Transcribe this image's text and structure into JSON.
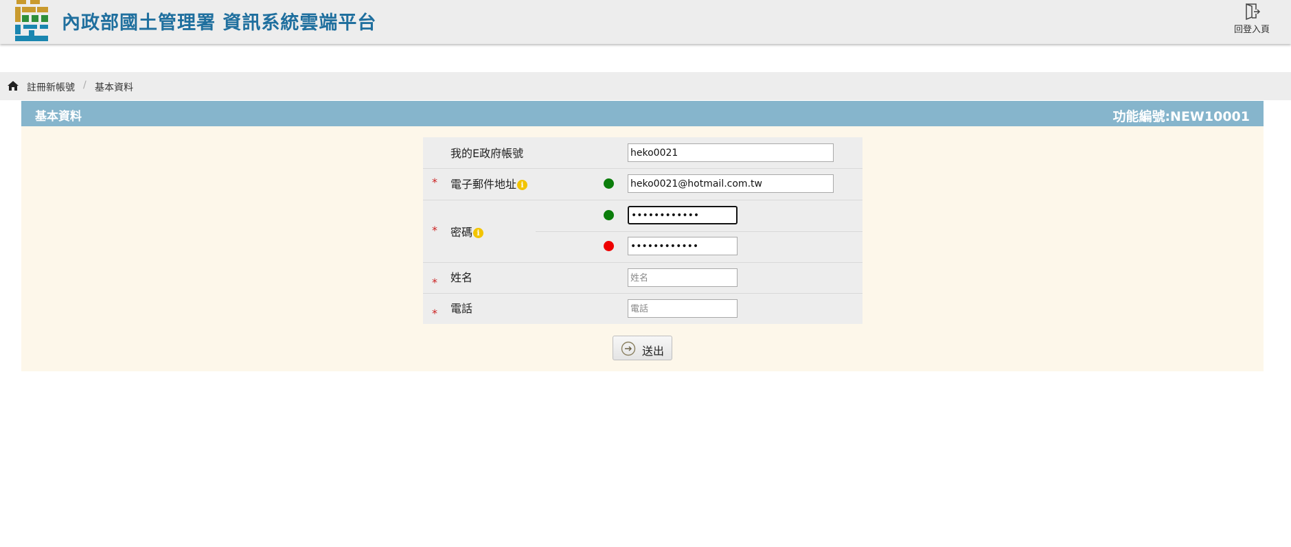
{
  "header": {
    "site_title": "內政部國土管理署 資訊系統雲端平台",
    "back_login_label": "回登入頁"
  },
  "breadcrumb": {
    "items": [
      "註冊新帳號",
      "基本資料"
    ],
    "separator": "/"
  },
  "panel": {
    "title": "基本資料",
    "function_code": "功能編號:NEW10001"
  },
  "form": {
    "egov_account": {
      "label": "我的E政府帳號",
      "value": "heko0021"
    },
    "email": {
      "required_mark": "*",
      "label": "電子郵件地址",
      "value": "heko0021@hotmail.com.tw",
      "status": "green"
    },
    "password": {
      "required_mark": "*",
      "label": "密碼",
      "value": "••••••••••••",
      "status": "green",
      "confirm_value": "••••••••••••",
      "confirm_status": "red"
    },
    "name": {
      "required_mark": "*",
      "label": "姓名",
      "placeholder": "姓名",
      "value": ""
    },
    "phone": {
      "required_mark": "*",
      "label": "電話",
      "placeholder": "電話",
      "value": ""
    },
    "info_glyph": "i",
    "submit_label": "送出"
  },
  "colors": {
    "title_blue": "#1f6f9e",
    "panel_header": "#86b5cc",
    "panel_body": "#fdf7ea",
    "status_ok": "#0b7d0b",
    "status_error": "#ee0000",
    "required": "#cc2222"
  },
  "icons": [
    "agency-logo-icon",
    "exit-door-icon",
    "home-icon",
    "info-icon",
    "arrow-circle-right-icon"
  ]
}
